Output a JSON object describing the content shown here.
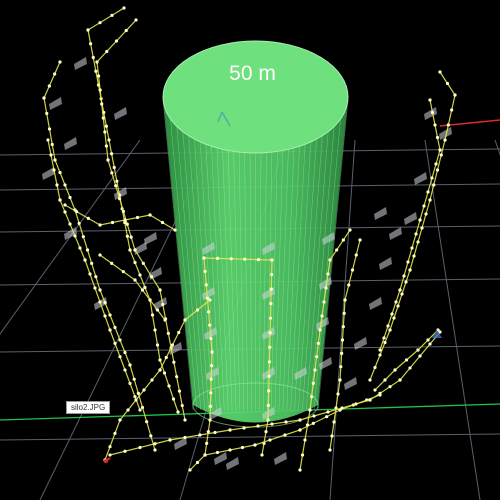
{
  "scene": {
    "radius_label": "50 m",
    "photo_label": "silo2.JPG",
    "colors": {
      "background": "#000000",
      "grid": "#5a5f6e",
      "silo_fill": "#55d86a",
      "silo_top": "#6fe07e",
      "flight_path": "#e8e84a",
      "waypoint": "#ffffcc",
      "camera_frustum": "#cfd3dc",
      "axis_x": "#e02a2a",
      "axis_y": "#22c24a"
    },
    "icons": [
      "north-arrow-icon",
      "axis-origin-icon"
    ]
  }
}
